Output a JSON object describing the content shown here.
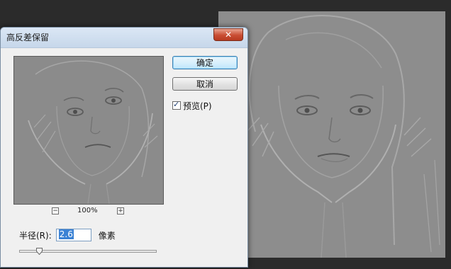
{
  "dialog": {
    "title": "高反差保留",
    "ok_label": "确定",
    "cancel_label": "取消",
    "preview_checkbox_label": "预览(P)",
    "preview_checked": true,
    "zoom": {
      "out_symbol": "−",
      "level": "100%",
      "in_symbol": "+"
    },
    "radius": {
      "label": "半径(R):",
      "value": "2.6",
      "unit": "像素",
      "slider_fraction": 0.14
    }
  },
  "icons": {
    "close": "close-icon",
    "zoom_out": "minus-icon",
    "zoom_in": "plus-icon",
    "check": "checkmark-icon"
  },
  "colors": {
    "titlebar": "#c6d7ea",
    "close_button": "#c94d33",
    "ok_button_border": "#3c7fb1",
    "canvas_gray": "#8c8c8c",
    "selection": "#3b82d4"
  }
}
